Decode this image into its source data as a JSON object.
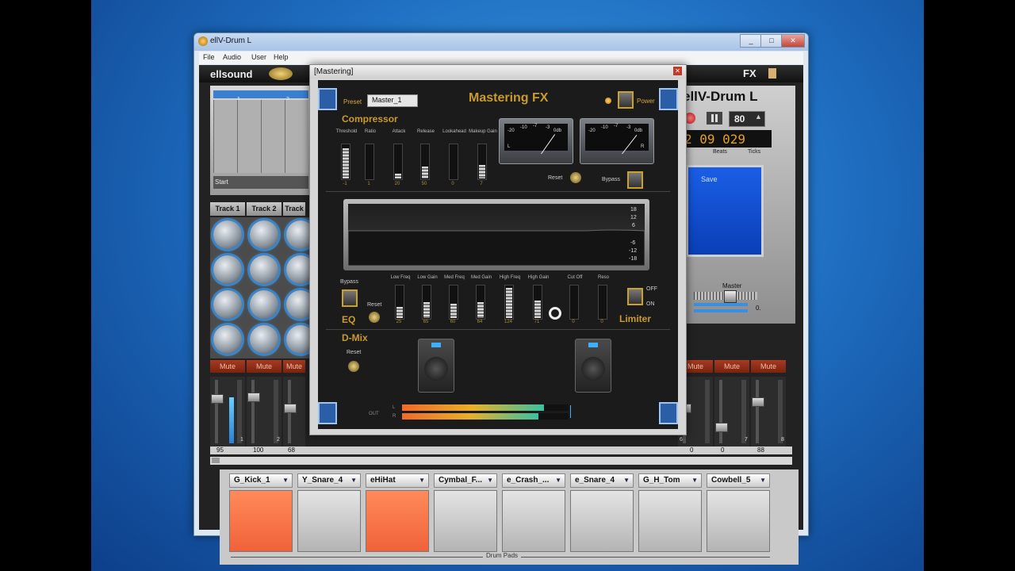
{
  "main_window": {
    "title": "ellV-Drum L",
    "menu": [
      "File",
      "Audio",
      "User",
      "Help"
    ],
    "controls": [
      "_",
      "□",
      "✕"
    ]
  },
  "app": {
    "brand": "ellsound",
    "fx_label": "FX",
    "product_name": "ellV-Drum L",
    "tempo": "80",
    "counter": "2 09 029",
    "counter_labels": [
      "s",
      "Beats",
      "Ticks"
    ],
    "save_label": "Save",
    "timeline_start": "Start",
    "timeline_marks": [
      "1",
      "2"
    ],
    "tracks": [
      "Track 1",
      "Track 2",
      "Track"
    ],
    "mute_label": "Mute",
    "fader_values_left": [
      "95",
      "100",
      "68"
    ],
    "fader_values_right": [
      "0",
      "0",
      "88"
    ],
    "fader_channel_nums": [
      "1",
      "2",
      "6",
      "7",
      "8"
    ],
    "master_label": "Master",
    "master_value": "0.",
    "pads": [
      {
        "name": "G_Kick_1",
        "color": "#f0623a"
      },
      {
        "name": "Y_Snare_4",
        "color": "#c7c7c7"
      },
      {
        "name": "eHiHat",
        "color": "#f0623a"
      },
      {
        "name": "Cymbal_F...",
        "color": "#c7c7c7"
      },
      {
        "name": "e_Crash_...",
        "color": "#c7c7c7"
      },
      {
        "name": "e_Snare_4",
        "color": "#c7c7c7"
      },
      {
        "name": "G_H_Tom",
        "color": "#c7c7c7"
      },
      {
        "name": "Cowbell_5",
        "color": "#c7c7c7"
      }
    ],
    "drum_pads_label": "Drum Pads"
  },
  "mastering": {
    "window_title": "[Mastering]",
    "preset_label": "Preset",
    "preset_value": "Master_1",
    "heading": "Mastering FX",
    "power_label": "Power",
    "compressor": {
      "title": "Compressor",
      "params": [
        {
          "label": "Threshold",
          "value": "-1",
          "fill": 0.9
        },
        {
          "label": "Ratio",
          "value": "1",
          "fill": 0.0
        },
        {
          "label": "Attack",
          "value": "20",
          "fill": 0.15
        },
        {
          "label": "Release",
          "value": "50",
          "fill": 0.35
        },
        {
          "label": "Lookahead",
          "value": "0",
          "fill": 0.0
        },
        {
          "label": "Makeup Gain",
          "value": "7",
          "fill": 0.4
        }
      ],
      "meter_scale": [
        "-20",
        "-10",
        "-7",
        "-5",
        "-3",
        "0db"
      ],
      "meter_channels": [
        "L",
        "R"
      ],
      "reset_label": "Reset",
      "bypass_label": "Bypass"
    },
    "spectrum_scale": [
      "18",
      "12",
      "6",
      "-6",
      "-12",
      "-18"
    ],
    "eq": {
      "title": "EQ",
      "bypass_label": "Bypass",
      "reset_label": "Reset",
      "params": [
        {
          "label": "Low Freq",
          "value": "25",
          "fill": 0.35
        },
        {
          "label": "Low Gain",
          "value": "65",
          "fill": 0.5
        },
        {
          "label": "Med Freq",
          "value": "60",
          "fill": 0.45
        },
        {
          "label": "Med Gain",
          "value": "64",
          "fill": 0.5
        },
        {
          "label": "High Freq",
          "value": "124",
          "fill": 0.95
        },
        {
          "label": "High Gain",
          "value": "71",
          "fill": 0.55
        },
        {
          "label": "Cut Off",
          "value": "0",
          "fill": 0.0
        },
        {
          "label": "Reso",
          "value": "0",
          "fill": 0.0
        }
      ]
    },
    "limiter": {
      "title": "Limiter",
      "off_label": "OFF",
      "on_label": "ON"
    },
    "dmix": {
      "title": "D-Mix",
      "reset_label": "Reset"
    },
    "output": {
      "label": "OUT",
      "channels": [
        "L",
        "R"
      ],
      "levels": [
        0.85,
        0.82
      ]
    }
  }
}
